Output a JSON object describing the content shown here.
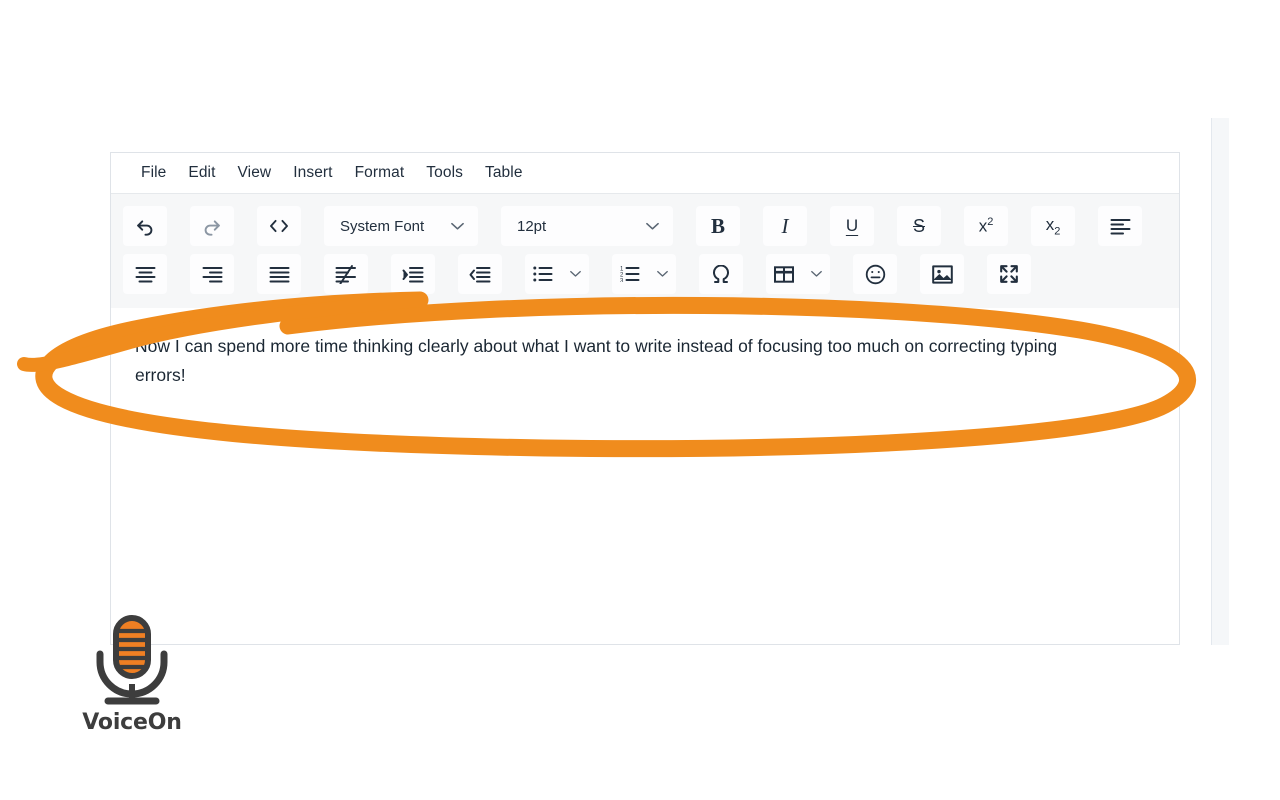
{
  "app": {
    "brand_name": "VoiceOn",
    "accent_color": "#f28c1e",
    "logo_icon": "microphone-icon"
  },
  "editor": {
    "menubar": [
      {
        "label": "File",
        "name": "menu-file"
      },
      {
        "label": "Edit",
        "name": "menu-edit"
      },
      {
        "label": "View",
        "name": "menu-view"
      },
      {
        "label": "Insert",
        "name": "menu-insert"
      },
      {
        "label": "Format",
        "name": "menu-format"
      },
      {
        "label": "Tools",
        "name": "menu-tools"
      },
      {
        "label": "Table",
        "name": "menu-table"
      }
    ],
    "toolbar": {
      "row1": [
        {
          "icon": "undo-icon",
          "label": "Undo"
        },
        {
          "icon": "redo-icon",
          "label": "Redo"
        },
        {
          "icon": "source-code-icon",
          "label": "Source code"
        },
        {
          "icon": "bold-icon",
          "label": "Bold",
          "glyph": "B"
        },
        {
          "icon": "italic-icon",
          "label": "Italic",
          "glyph": "I"
        },
        {
          "icon": "underline-icon",
          "label": "Underline",
          "glyph": "U"
        },
        {
          "icon": "strikethrough-icon",
          "label": "Strikethrough",
          "glyph": "S"
        },
        {
          "icon": "superscript-icon",
          "label": "Superscript",
          "glyph": "x²"
        },
        {
          "icon": "subscript-icon",
          "label": "Subscript",
          "glyph": "x₂"
        },
        {
          "icon": "align-left-icon",
          "label": "Align left"
        }
      ],
      "row2": [
        {
          "icon": "align-center-icon",
          "label": "Align center"
        },
        {
          "icon": "align-right-icon",
          "label": "Align right"
        },
        {
          "icon": "justify-icon",
          "label": "Justify"
        },
        {
          "icon": "clear-formatting-icon",
          "label": "Clear formatting"
        },
        {
          "icon": "indent-icon",
          "label": "Increase indent"
        },
        {
          "icon": "outdent-icon",
          "label": "Decrease indent"
        },
        {
          "icon": "bullet-list-icon",
          "label": "Bullet list"
        },
        {
          "icon": "numbered-list-icon",
          "label": "Numbered list"
        },
        {
          "icon": "special-character-icon",
          "label": "Special character"
        },
        {
          "icon": "table-icon",
          "label": "Table"
        },
        {
          "icon": "emoji-icon",
          "label": "Emoticons"
        },
        {
          "icon": "image-icon",
          "label": "Insert image"
        },
        {
          "icon": "fullscreen-icon",
          "label": "Fullscreen"
        }
      ],
      "font_family": {
        "value": "System Font",
        "caret_icon": "chevron-down-icon"
      },
      "font_size": {
        "value": "12pt",
        "caret_icon": "chevron-down-icon"
      }
    },
    "body_text": "Now I can spend more time thinking clearly about what I want to write instead of focusing too much on correcting typing errors!"
  },
  "annotation": {
    "type": "hand-drawn-ellipse-highlight",
    "color": "#f28c1e"
  }
}
